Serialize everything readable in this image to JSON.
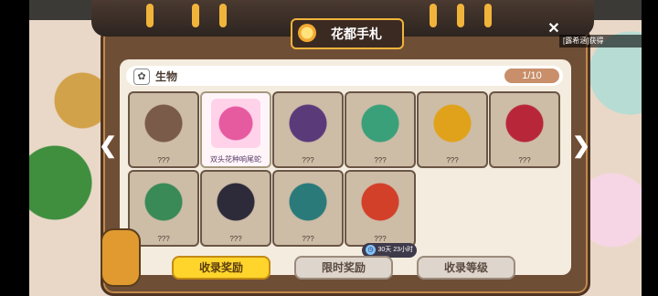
{
  "panel": {
    "title": "花都手札",
    "close_icon": "close-icon"
  },
  "notification": {
    "prefix": "[露希涵]获得",
    "highlight": ""
  },
  "section": {
    "label": "生物",
    "progress": "1/10",
    "icon": "creature-icon"
  },
  "cards": [
    {
      "name": "???",
      "unlocked": false,
      "color": "#7a5a48"
    },
    {
      "name": "双头花种响尾蛇",
      "unlocked": true,
      "color": "#e65aa0"
    },
    {
      "name": "???",
      "unlocked": false,
      "color": "#5b3a7a"
    },
    {
      "name": "???",
      "unlocked": false,
      "color": "#3aa07a"
    },
    {
      "name": "???",
      "unlocked": false,
      "color": "#e0a21a"
    },
    {
      "name": "???",
      "unlocked": false,
      "color": "#b8263a"
    },
    {
      "name": "???",
      "unlocked": false,
      "color": "#3a8a58"
    },
    {
      "name": "???",
      "unlocked": false,
      "color": "#2d2a3a"
    },
    {
      "name": "???",
      "unlocked": false,
      "color": "#2b7a7a"
    },
    {
      "name": "???",
      "unlocked": false,
      "color": "#d2402a"
    }
  ],
  "timer": "30天 23小时",
  "buttons": {
    "collect_reward": "收录奖励",
    "limited_reward": "限时奖励",
    "collect_level": "收录等级"
  },
  "nav": {
    "prev": "❮",
    "next": "❯"
  }
}
